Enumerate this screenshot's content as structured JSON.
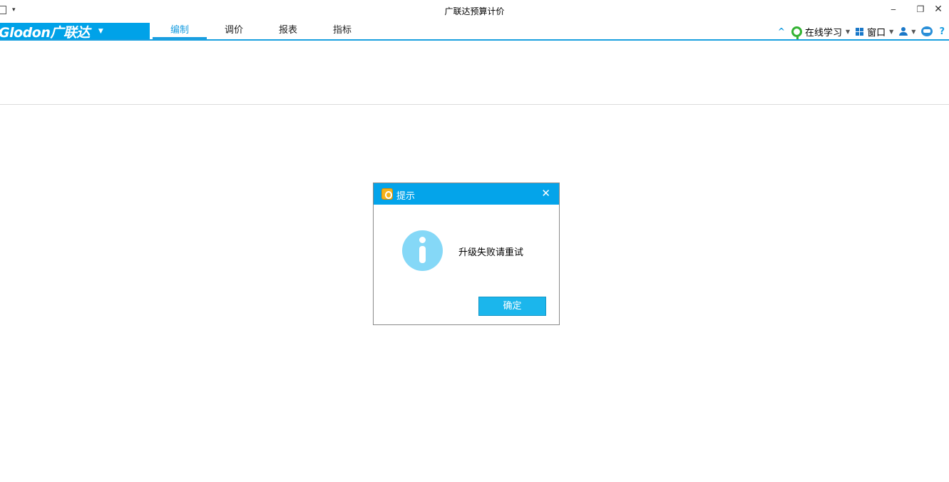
{
  "window": {
    "title": "广联达预算计价",
    "minimize_glyph": "‒",
    "restore_glyph": "❐",
    "close_glyph": "✕"
  },
  "brand": {
    "logo_text": "Glodon广联达",
    "caret": "▼"
  },
  "tabs": [
    {
      "label": "编制",
      "active": true
    },
    {
      "label": "调价",
      "active": false
    },
    {
      "label": "报表",
      "active": false
    },
    {
      "label": "指标",
      "active": false
    }
  ],
  "toolbar_right": {
    "collapse_glyph": "^",
    "online_learning": "在线学习",
    "window": "窗口",
    "caret": "▼",
    "help": "?"
  },
  "dialog": {
    "title": "提示",
    "close_glyph": "✕",
    "message": "升级失败请重试",
    "ok_label": "确定"
  },
  "colors": {
    "accent": "#00a2e8",
    "dialog_header": "#04a4ea",
    "ok_button": "#1bb6ec",
    "info_icon": "#85d8f7"
  }
}
